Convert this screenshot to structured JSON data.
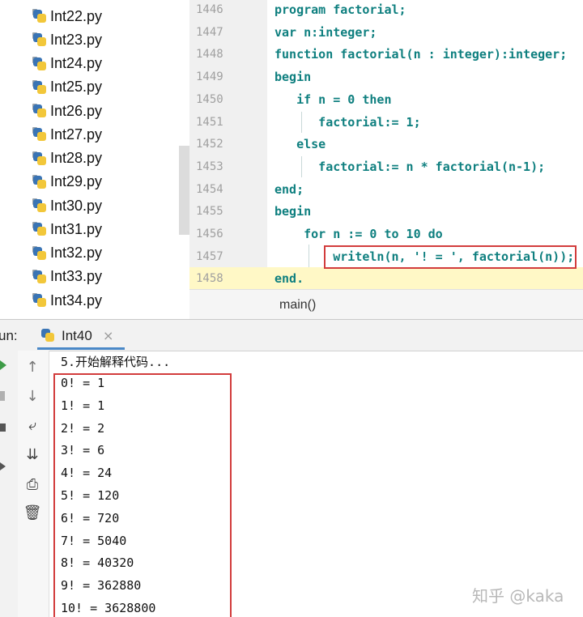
{
  "project_tree": {
    "files": [
      "Int22.py",
      "Int23.py",
      "Int24.py",
      "Int25.py",
      "Int26.py",
      "Int27.py",
      "Int28.py",
      "Int29.py",
      "Int30.py",
      "Int31.py",
      "Int32.py",
      "Int33.py",
      "Int34.py"
    ]
  },
  "editor": {
    "line_numbers": [
      "1446",
      "1447",
      "1448",
      "1449",
      "1450",
      "1451",
      "1452",
      "1453",
      "1454",
      "1455",
      "1456",
      "1457",
      "1458"
    ],
    "lines": [
      "program factorial;",
      "var n:integer;",
      "function factorial(n : integer):integer;",
      "begin",
      "   if n = 0 then",
      "      factorial:= 1;",
      "   else",
      "      factorial:= n * factorial(n-1);",
      "end;",
      "begin",
      "    for n := 0 to 10 do",
      "        writeln(n, '! = ', factorial(n));",
      "end."
    ],
    "breadcrumb": "main()"
  },
  "run_panel": {
    "label": "un:",
    "tab_title": "Int40",
    "close_glyph": "×",
    "header_line": "5.开始解释代码...",
    "output": [
      "0! = 1",
      "1! = 1",
      "2! = 2",
      "3! = 6",
      "4! = 24",
      "5! = 120",
      "6! = 720",
      "7! = 5040",
      "8! = 40320",
      "9! = 362880",
      "10! = 3628800"
    ]
  },
  "watermark": "知乎 @kaka",
  "colors": {
    "code": "#0e7f7f",
    "highlight_box": "#d23c3c",
    "tab_underline": "#4a88c7"
  }
}
